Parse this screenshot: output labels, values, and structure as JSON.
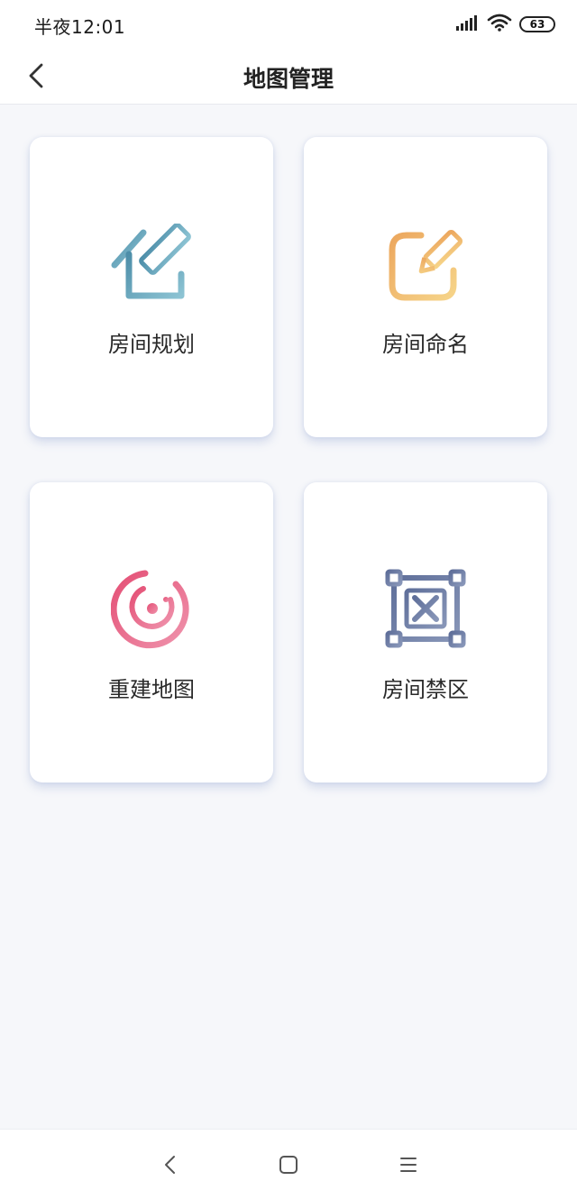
{
  "status_bar": {
    "time": "半夜12:01",
    "battery": "63",
    "icons": [
      "signal-icon",
      "wifi-icon",
      "battery-icon"
    ]
  },
  "header": {
    "title": "地图管理",
    "back_icon": "chevron-left-icon"
  },
  "cards": [
    {
      "label": "房间规划",
      "icon": "house-ruler-icon",
      "color": "#5f9fb8"
    },
    {
      "label": "房间命名",
      "icon": "edit-pencil-icon",
      "color": "#f0b36a"
    },
    {
      "label": "重建地图",
      "icon": "radar-icon",
      "color": "#e4607f"
    },
    {
      "label": "房间禁区",
      "icon": "forbidden-zone-icon",
      "color": "#6e7ea6"
    }
  ],
  "system_nav": {
    "icons": [
      "back-icon",
      "home-icon",
      "menu-icon"
    ]
  }
}
